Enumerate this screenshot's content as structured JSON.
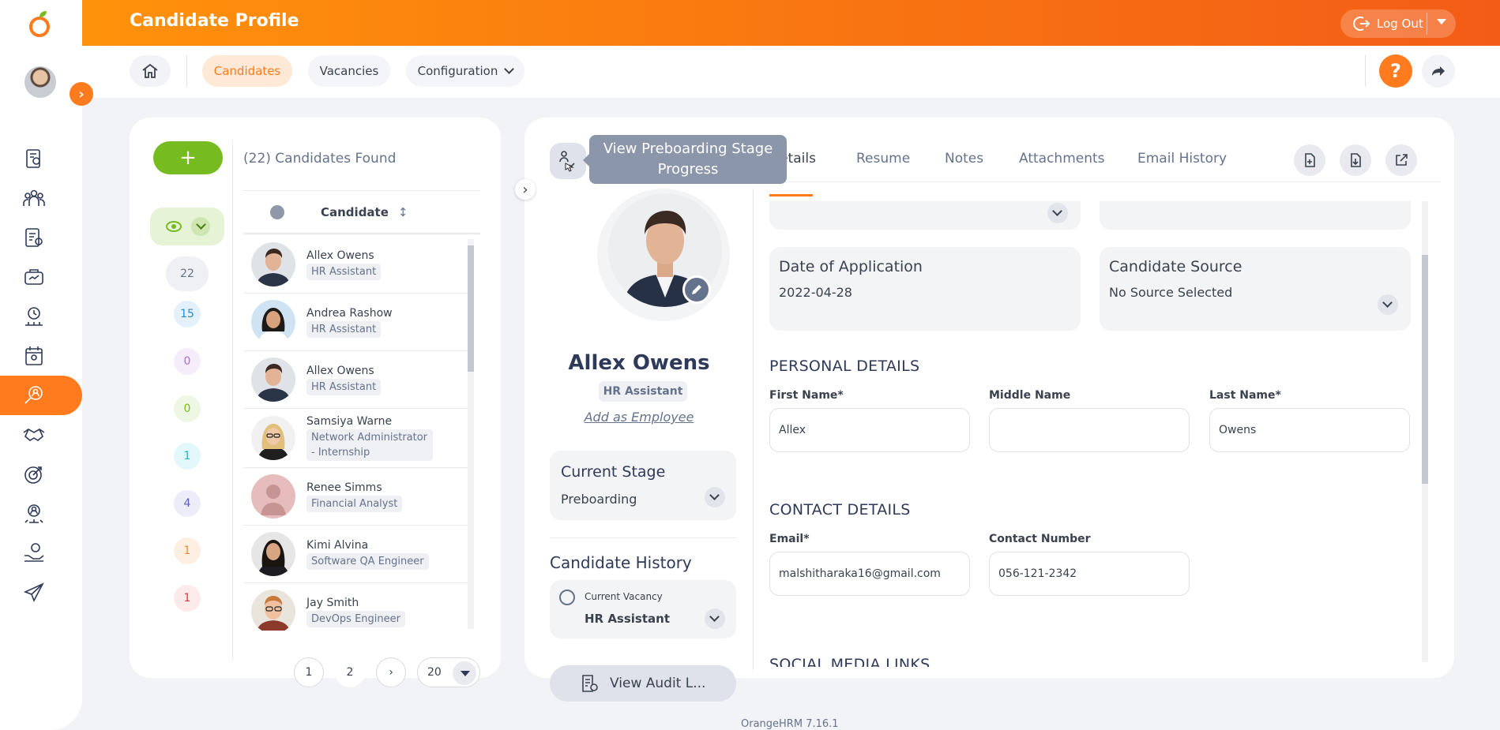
{
  "header": {
    "title": "Candidate Profile",
    "logout_label": "Log Out"
  },
  "nav": {
    "items": [
      {
        "label": "Candidates",
        "active": true
      },
      {
        "label": "Vacancies",
        "active": false
      },
      {
        "label": "Configuration",
        "active": false
      }
    ],
    "help_label": "?"
  },
  "sidebar": {
    "icons": [
      "directory-icon",
      "team-icon",
      "report-icon",
      "performance-icon",
      "time-icon",
      "calendar-icon",
      "recruitment-icon",
      "handshake-icon",
      "goals-icon",
      "awards-icon",
      "claim-icon",
      "travel-icon"
    ],
    "active": "recruitment-icon"
  },
  "candidates_panel": {
    "add_label": "+",
    "found_label": "(22) Candidates Found",
    "column_header": "Candidate",
    "counts": [
      {
        "value": "22",
        "color": "#64728c",
        "bg": "#eef0f4"
      },
      {
        "value": "15",
        "color": "#2a8bd6",
        "bg": "#e4f1fb"
      },
      {
        "value": "0",
        "color": "#b36ad6",
        "bg": "#f6edfb"
      },
      {
        "value": "0",
        "color": "#76bc21",
        "bg": "#eef7e4"
      },
      {
        "value": "1",
        "color": "#18b8c9",
        "bg": "#e3f8fa"
      },
      {
        "value": "4",
        "color": "#5b5fb5",
        "bg": "#ecedf8"
      },
      {
        "value": "1",
        "color": "#f08a2c",
        "bg": "#fdf0e3"
      },
      {
        "value": "1",
        "color": "#e0393e",
        "bg": "#fdebeb"
      }
    ],
    "list": [
      {
        "name": "Allex Owens",
        "role": "HR Assistant",
        "photo": "man1"
      },
      {
        "name": "Andrea Rashow",
        "role": "HR Assistant",
        "photo": "woman1"
      },
      {
        "name": "Allex Owens",
        "role": "HR Assistant",
        "photo": "man1"
      },
      {
        "name": "Samsiya Warne",
        "role": "Network Administrator - Internship",
        "photo": "woman2"
      },
      {
        "name": "Renee Simms",
        "role": "Financial Analyst",
        "photo": "placeholder"
      },
      {
        "name": "Kimi Alvina",
        "role": "Software QA Engineer",
        "photo": "woman3"
      },
      {
        "name": "Jay Smith",
        "role": "DevOps Engineer",
        "photo": "man2"
      }
    ],
    "pager": {
      "pages": [
        "1",
        "2"
      ],
      "page_size": "20"
    }
  },
  "profile": {
    "tooltip": "View Preboarding Stage Progress",
    "name": "Allex Owens",
    "role": "HR Assistant",
    "add_employee": "Add as Employee",
    "current_stage_label": "Current Stage",
    "current_stage_value": "Preboarding",
    "history_title": "Candidate History",
    "history_sub": "Current Vacancy",
    "history_value": "HR Assistant",
    "audit_label": "View Audit L..."
  },
  "tabs": [
    "Details",
    "Resume",
    "Notes",
    "Attachments",
    "Email History"
  ],
  "details": {
    "date_label": "Date of Application",
    "date_value": "2022-04-28",
    "source_label": "Candidate Source",
    "source_value": "No Source Selected",
    "personal_title": "PERSONAL DETAILS",
    "first_name_label": "First Name*",
    "first_name_value": "Allex",
    "middle_name_label": "Middle Name",
    "middle_name_value": "",
    "last_name_label": "Last Name*",
    "last_name_value": "Owens",
    "contact_title": "CONTACT DETAILS",
    "email_label": "Email*",
    "email_value": "malshitharaka16@gmail.com",
    "contact_label": "Contact Number",
    "contact_value": "056-121-2342",
    "social_title": "SOCIAL MEDIA LINKS"
  },
  "footer": {
    "version": "OrangeHRM 7.16.1"
  }
}
